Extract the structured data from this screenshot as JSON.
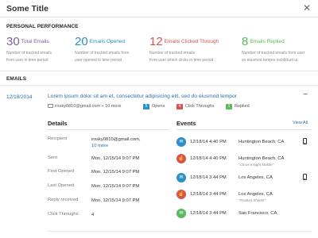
{
  "window": {
    "title": "Some Title",
    "close_glyph": "✕"
  },
  "performance": {
    "heading": "PERSONAL PERFORMANCE",
    "metrics": [
      {
        "value": "30",
        "label": "Total Emails",
        "desc1": "Number of tracked emails",
        "desc2": "from user in time period",
        "color": "#7b5ea7"
      },
      {
        "value": "20",
        "label": "Emails Opened",
        "desc1": "Number of tracked emails from",
        "desc2": "user opened in time period",
        "color": "#2b8fc8"
      },
      {
        "value": "12",
        "label": "Emails Clicked Through",
        "desc1": "Number of tracked emails",
        "desc2": "from user which clicks in time period",
        "color": "#d9534f"
      },
      {
        "value": "8",
        "label": "Emails Replied",
        "desc1": "Number of tracked emails from user",
        "desc2": "so eiusmod tempor incididunt ut",
        "color": "#5cb85c"
      }
    ]
  },
  "emails": {
    "heading": "EMAILS",
    "date": "12/18/2014",
    "subject": "Lorem ipsum dolor sit am et, consectetur adipisicing elit, sed do eiusmod tempor",
    "collapse_glyph": "−",
    "recipient_summary": "irssky0810@gmail.com + 10 more",
    "opens_count": "5",
    "opens_label": "Opens",
    "clicks_count": "4",
    "clicks_label": "Click Throughs",
    "replies_count": "1",
    "replies_label": "Replied",
    "colors": {
      "opens": "#2b8fc8",
      "clicks": "#d9534f",
      "replies": "#5cb85c"
    }
  },
  "details": {
    "heading": "Details",
    "recipient_label": "Recipient",
    "recipient_value": "irssky0810@gmail.com,",
    "recipient_more": "10 more",
    "sent_label": "Sent",
    "sent_value": "Mon, 12/15/14  9:07 PM",
    "first_opened_label": "First Opened",
    "first_opened_value": "Mon, 12/15/14  9:07 PM",
    "last_opened_label": "Last Opened",
    "last_opened_value": "Mon, 12/15/14  9:07 PM",
    "reply_label": "Reply received",
    "reply_value": "Mon, 12/15/14  9:07 PM",
    "clicks_label": "Click Throughs",
    "clicks_value": "4"
  },
  "events": {
    "heading": "Events",
    "view_all": "View All",
    "items": [
      {
        "time": "12/18/14 4:40 PM",
        "location": "Huntington Beach, CA",
        "subtitle": "",
        "type": "open",
        "icon": "mail-open-icon",
        "glyph": "✉",
        "color": "#2b8fc8",
        "device": "phone"
      },
      {
        "time": "12/18/14 4:40 PM",
        "location": "Huntington Beach, CA",
        "subtitle": "\"Cirrus Insight Mobile\"",
        "type": "click",
        "icon": "pointer-icon",
        "glyph": "☝",
        "color": "#d9534f",
        "device": ""
      },
      {
        "time": "12/18/14 3:44 PM",
        "location": "Los Angeles, CA",
        "subtitle": "",
        "type": "open",
        "icon": "mail-open-icon",
        "glyph": "✉",
        "color": "#2b8fc8",
        "device": "phone"
      },
      {
        "time": "12/18/14 3:44 PM",
        "location": "Los Angeles, CA",
        "subtitle": "\"Product Sheets\"",
        "type": "click",
        "icon": "pointer-icon",
        "glyph": "☝",
        "color": "#d9534f",
        "device": ""
      },
      {
        "time": "12/18/14 3:44 PM",
        "location": "San Francisco, CA",
        "subtitle": "",
        "type": "reply",
        "icon": "mail-reply-icon",
        "glyph": "✉",
        "color": "#5cb85c",
        "device": ""
      }
    ]
  }
}
